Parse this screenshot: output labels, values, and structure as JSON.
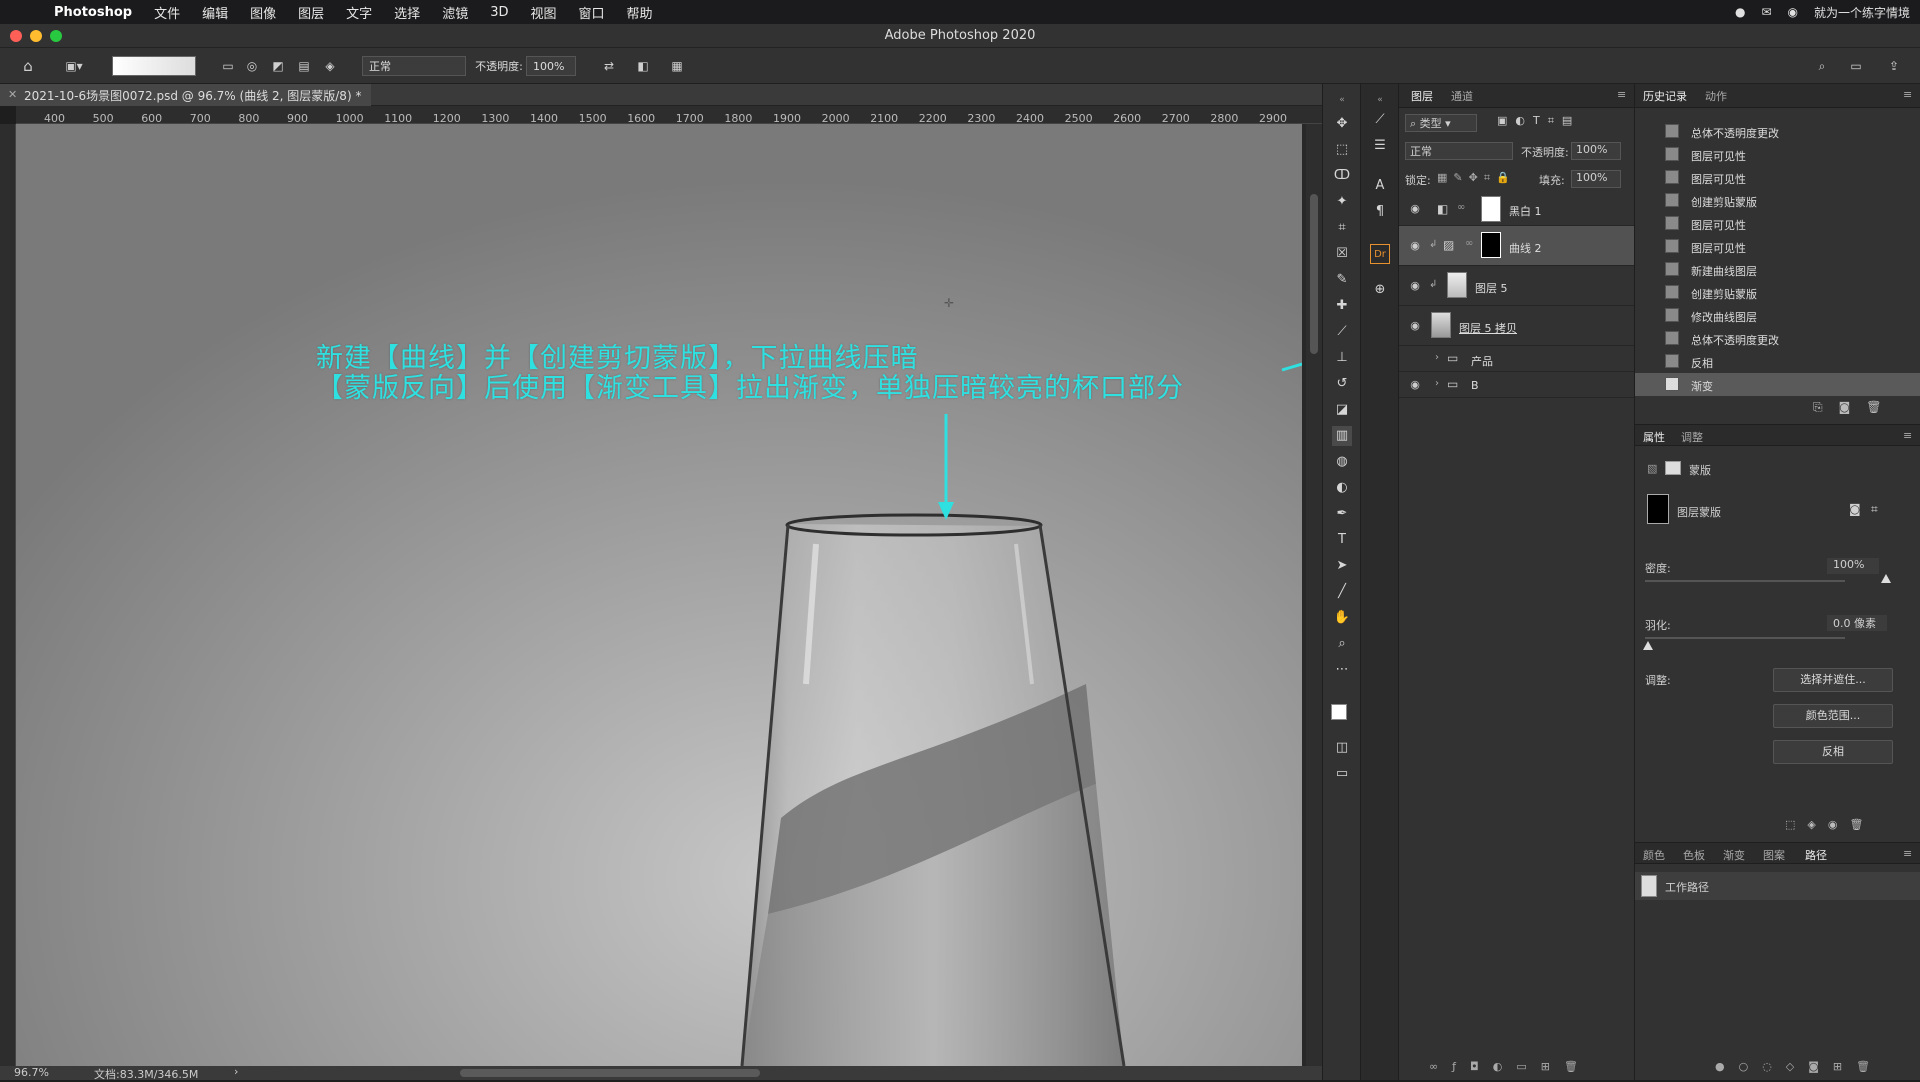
{
  "menubar": {
    "app_name": "Photoshop",
    "items": [
      "文件",
      "编辑",
      "图像",
      "图层",
      "文字",
      "选择",
      "滤镜",
      "3D",
      "视图",
      "窗口",
      "帮助"
    ],
    "right_text": "就为一个练字情境"
  },
  "window": {
    "title": "Adobe Photoshop 2020"
  },
  "options": {
    "mode": "正常",
    "opacity_label": "不透明度:",
    "opacity_value": "100%"
  },
  "document": {
    "tab_title": "2021-10-6场景图0072.psd @ 96.7% (曲线 2, 图层蒙版/8) *"
  },
  "ruler": {
    "ticks": [
      "400",
      "500",
      "600",
      "700",
      "800",
      "900",
      "1000",
      "1100",
      "1200",
      "1300",
      "1400",
      "1500",
      "1600",
      "1700",
      "1800",
      "1900",
      "2000",
      "2100",
      "2200",
      "2300",
      "2400",
      "2500",
      "2600",
      "2700",
      "2800",
      "2900"
    ]
  },
  "canvas": {
    "caption_line1": "新建【曲线】并【创建剪切蒙版】，下拉曲线压暗",
    "caption_line2": "【蒙版反向】后使用【渐变工具】拉出渐变，单独压暗较亮的杯口部分",
    "annotation_color": "#2fe0e0"
  },
  "status": {
    "zoom": "96.7%",
    "doc_size": "文档:83.3M/346.5M"
  },
  "layers_panel": {
    "tabs": [
      "图层",
      "通道"
    ],
    "filter_label": "类型",
    "blend_mode": "正常",
    "opacity_label": "不透明度:",
    "opacity_value": "100%",
    "lock_label": "锁定:",
    "fill_label": "填充:",
    "fill_value": "100%",
    "layers": [
      {
        "name": "黑白 1",
        "visible": true
      },
      {
        "name": "曲线 2",
        "visible": true,
        "selected": true
      },
      {
        "name": "图层 5",
        "visible": true
      },
      {
        "name": "图层 5 拷贝",
        "visible": true
      },
      {
        "name": "产品",
        "visible": false,
        "group": true
      },
      {
        "name": "B",
        "visible": true,
        "group": true
      }
    ]
  },
  "history_panel": {
    "tabs": [
      "历史记录",
      "动作"
    ],
    "items": [
      "总体不透明度更改",
      "图层可见性",
      "图层可见性",
      "创建剪贴蒙版",
      "图层可见性",
      "图层可见性",
      "新建曲线图层",
      "创建剪贴蒙版",
      "修改曲线图层",
      "总体不透明度更改",
      "反相",
      "渐变"
    ]
  },
  "properties_panel": {
    "tabs": [
      "属性",
      "调整"
    ],
    "mask_label": "蒙版",
    "layer_mask_label": "图层蒙版",
    "density_label": "密度:",
    "density_value": "100%",
    "feather_label": "羽化:",
    "feather_value": "0.0 像素",
    "adjust_label": "调整:",
    "btn_select_mask": "选择并遮住...",
    "btn_color_range": "颜色范围...",
    "btn_invert": "反相"
  },
  "paths_panel": {
    "tabs": [
      "颜色",
      "色板",
      "渐变",
      "图案",
      "路径"
    ],
    "item": "工作路径"
  }
}
